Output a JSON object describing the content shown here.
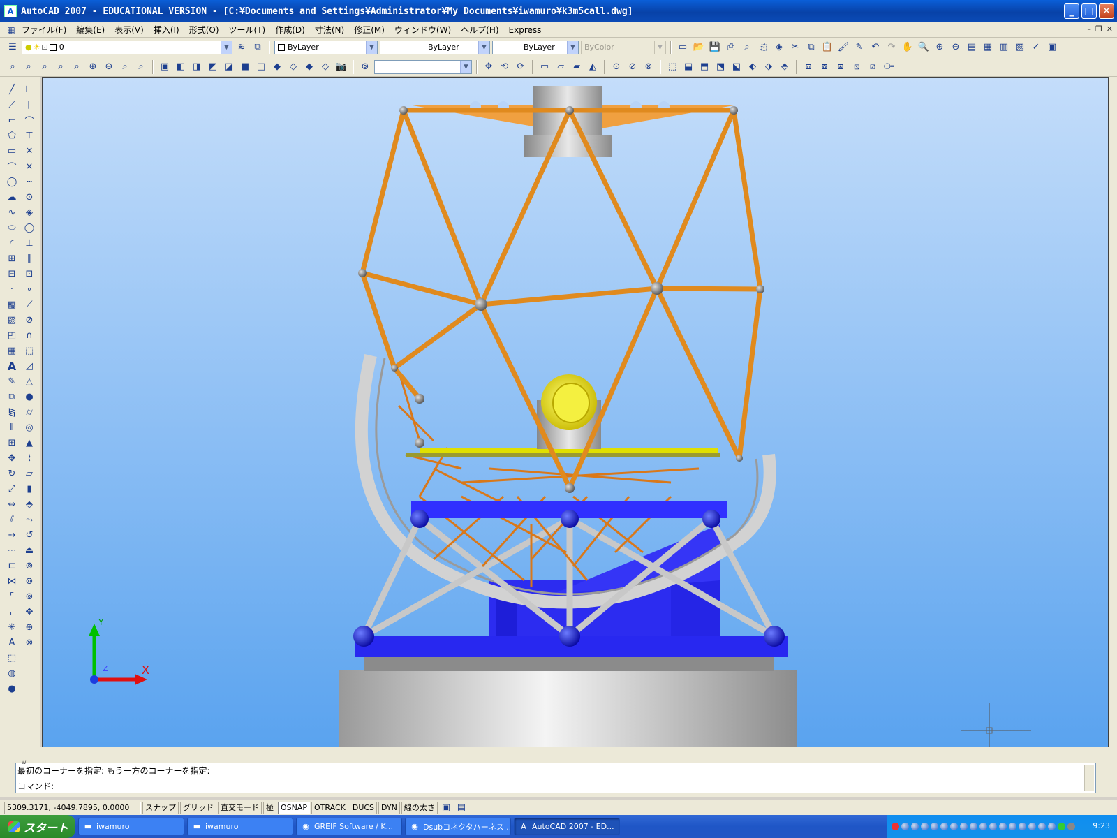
{
  "window": {
    "title": "AutoCAD 2007 - EDUCATIONAL VERSION - [C:¥Documents and Settings¥Administrator¥My Documents¥iwamuro¥k3m5call.dwg]",
    "minimize": "_",
    "maximize": "□",
    "close": "✕"
  },
  "menu": {
    "items": [
      "ファイル(F)",
      "編集(E)",
      "表示(V)",
      "挿入(I)",
      "形式(O)",
      "ツール(T)",
      "作成(D)",
      "寸法(N)",
      "修正(M)",
      "ウィンドウ(W)",
      "ヘルプ(H)",
      "Express"
    ]
  },
  "properties_toolbar": {
    "layer_value": "0",
    "color_value": "ByLayer",
    "linetype_value": "ByLayer",
    "lineweight_value": "ByLayer",
    "plotstyle_value": "ByColor"
  },
  "command_line": {
    "previous_line": "w",
    "history_line": "最初のコーナーを指定: もう一方のコーナーを指定:",
    "prompt": "コマンド:"
  },
  "status_bar": {
    "coordinates": "5309.3171, -4049.7895, 0.0000",
    "toggles": [
      "スナップ",
      "グリッド",
      "直交モード",
      "極",
      "OSNAP",
      "OTRACK",
      "DUCS",
      "DYN",
      "線の太さ"
    ],
    "active_toggles": [
      "OSNAP"
    ]
  },
  "ucs": {
    "x_label": "X",
    "y_label": "Y",
    "z_label": "Z"
  },
  "taskbar": {
    "start_label": "スタート",
    "tasks": [
      "iwamuro",
      "iwamuro",
      "GREIF Software / K...",
      "Dsubコネクタハーネス ...",
      "AutoCAD 2007 - ED..."
    ],
    "active_task_index": 4,
    "clock": "9:23"
  },
  "colors": {
    "titlebar": "#0842a8",
    "viewport_top": "#c4ddfa",
    "viewport_bottom": "#5aa3ef",
    "truss": "#e08a1e",
    "base_blue": "#2c2cf0"
  }
}
